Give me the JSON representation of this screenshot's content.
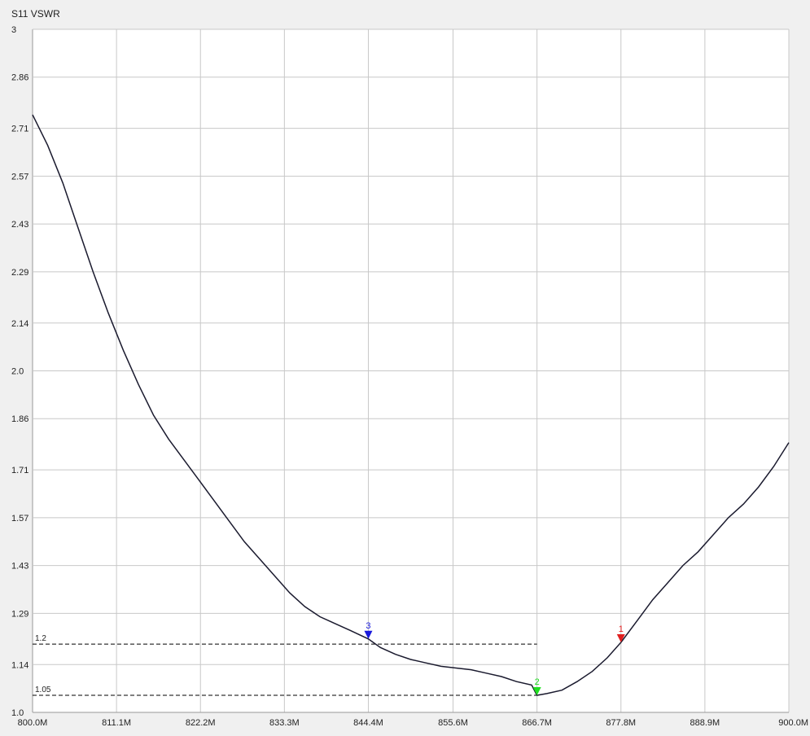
{
  "chart_data": {
    "type": "line",
    "title": "S11 VSWR",
    "xlabel": "",
    "ylabel": "",
    "xlim": [
      800.0,
      900.0
    ],
    "ylim": [
      1.0,
      3.0
    ],
    "grid": true,
    "x_tick_values": [
      800.0,
      811.1,
      822.2,
      833.3,
      844.4,
      855.6,
      866.7,
      877.8,
      888.9,
      900.0
    ],
    "x_tick_labels": [
      "800.0M",
      "811.1M",
      "822.2M",
      "833.3M",
      "844.4M",
      "855.6M",
      "866.7M",
      "877.8M",
      "888.9M",
      "900.0M"
    ],
    "y_tick_values": [
      1.0,
      1.14,
      1.29,
      1.43,
      1.57,
      1.71,
      1.86,
      2.0,
      2.14,
      2.29,
      2.43,
      2.57,
      2.71,
      2.86,
      3.0
    ],
    "y_tick_labels": [
      "1.0",
      "1.14",
      "1.29",
      "1.43",
      "1.57",
      "1.71",
      "1.86",
      "2.0",
      "2.14",
      "2.29",
      "2.43",
      "2.57",
      "2.71",
      "2.86",
      "3"
    ],
    "series": [
      {
        "color": "#1a1a2e",
        "x": [
          800.0,
          802.0,
          804.0,
          806.0,
          808.0,
          810.0,
          812.0,
          814.0,
          816.0,
          818.0,
          820.0,
          822.0,
          824.0,
          826.0,
          828.0,
          830.0,
          832.0,
          834.0,
          836.0,
          838.0,
          840.0,
          842.0,
          844.4,
          846.0,
          848.0,
          850.0,
          852.0,
          854.0,
          856.0,
          858.0,
          860.0,
          862.0,
          864.0,
          866.0,
          866.7,
          868.0,
          870.0,
          872.0,
          874.0,
          876.0,
          877.8,
          880.0,
          882.0,
          884.0,
          886.0,
          888.0,
          890.0,
          892.0,
          894.0,
          896.0,
          898.0,
          900.0
        ],
        "y": [
          2.75,
          2.66,
          2.55,
          2.42,
          2.29,
          2.17,
          2.06,
          1.96,
          1.87,
          1.8,
          1.74,
          1.68,
          1.62,
          1.56,
          1.5,
          1.45,
          1.4,
          1.35,
          1.31,
          1.28,
          1.26,
          1.24,
          1.215,
          1.19,
          1.17,
          1.155,
          1.145,
          1.135,
          1.13,
          1.125,
          1.115,
          1.105,
          1.09,
          1.08,
          1.05,
          1.055,
          1.065,
          1.09,
          1.12,
          1.16,
          1.205,
          1.27,
          1.33,
          1.38,
          1.43,
          1.47,
          1.52,
          1.57,
          1.61,
          1.66,
          1.72,
          1.79
        ]
      }
    ],
    "reference_lines": [
      {
        "value": 1.2,
        "label": "1.2"
      },
      {
        "value": 1.05,
        "label": "1.05"
      }
    ],
    "markers": [
      {
        "label": "1",
        "x": 877.8,
        "y": 1.205,
        "color": "#e02020"
      },
      {
        "label": "2",
        "x": 866.7,
        "y": 1.05,
        "color": "#20e020"
      },
      {
        "label": "3",
        "x": 844.4,
        "y": 1.215,
        "color": "#1a1adc"
      }
    ],
    "colors": {
      "background": "#f0f0f0",
      "plot_background": "#ffffff",
      "grid": "#c8c8c8",
      "axis": "#999999",
      "reference_line": "#000000"
    }
  }
}
